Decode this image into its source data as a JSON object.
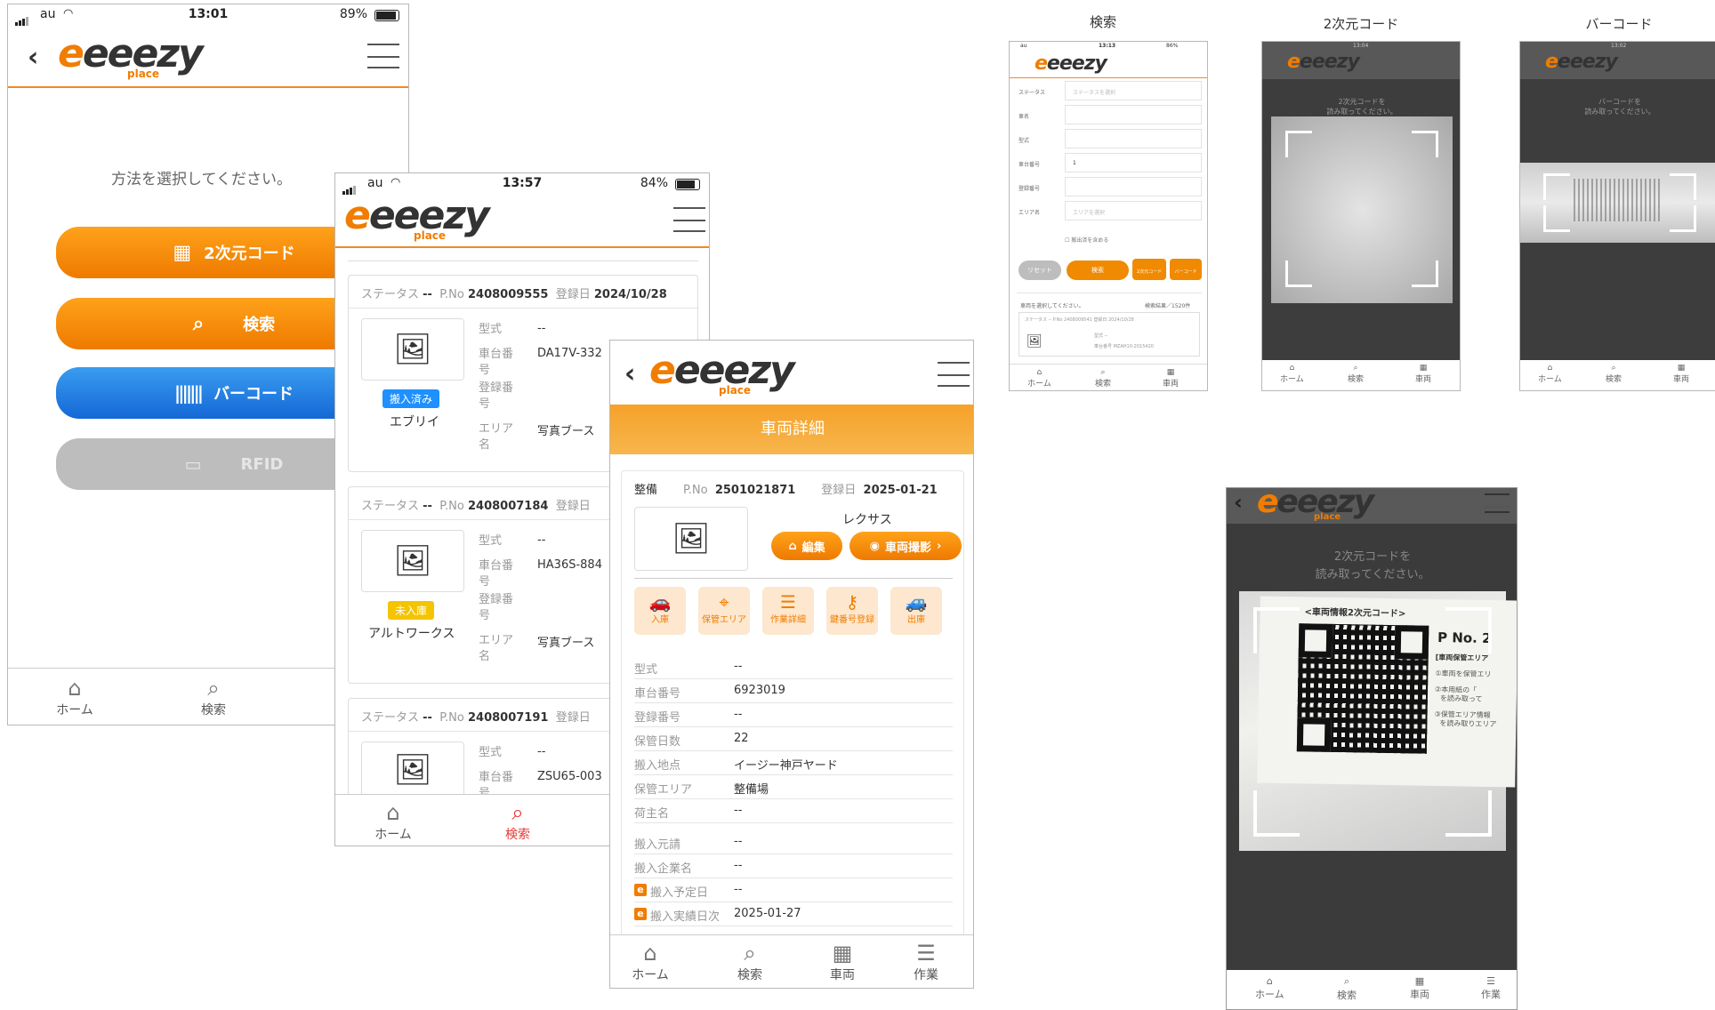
{
  "status": {
    "carrier": "au",
    "p1_time": "13:01",
    "p1_battery": "89%",
    "p2_time": "13:57",
    "p2_battery": "84%",
    "s1_time": "13:13",
    "s1_battery": "86%",
    "s2_time": "13:04",
    "s2_battery": "88%",
    "s3_time": "13:02",
    "s3_battery": "89%"
  },
  "logo": {
    "text_e": "e",
    "text_rest": "eeezy",
    "sub": "place"
  },
  "home": {
    "prompt": "方法を選択してください。",
    "buttons": [
      {
        "label": "2次元コード",
        "icon": "qr-code-icon"
      },
      {
        "label": "検索",
        "icon": "search-icon"
      },
      {
        "label": "バーコード",
        "icon": "barcode-icon"
      },
      {
        "label": "RFID",
        "icon": "rfid-icon"
      }
    ]
  },
  "tabs": {
    "home": "ホーム",
    "search": "検索",
    "vehicle": "車両",
    "work": "作業"
  },
  "list": {
    "cards": [
      {
        "status_label": "ステータス",
        "status": "--",
        "pno_label": "P.No",
        "pno": "2408009555",
        "date_label": "登録日",
        "date": "2024/10/28",
        "badge": "搬入済み",
        "badge_color": "#1e90ff",
        "name": "エブリイ",
        "model_label": "型式",
        "model": "--",
        "chassis_label": "車台番号",
        "chassis": "DA17V-332",
        "reg_label": "登録番号",
        "area_label": "エリア名",
        "area": "写真ブース"
      },
      {
        "status_label": "ステータス",
        "status": "--",
        "pno_label": "P.No",
        "pno": "2408007184",
        "date_label": "登録日",
        "badge": "未入庫",
        "badge_color": "#f5c400",
        "name": "アルトワークス",
        "model_label": "型式",
        "model": "--",
        "chassis_label": "車台番号",
        "chassis": "HA36S-884",
        "reg_label": "登録番号",
        "area_label": "エリア名",
        "area": "写真ブース"
      },
      {
        "status_label": "ステータス",
        "status": "--",
        "pno_label": "P.No",
        "pno": "2408007191",
        "date_label": "登録日",
        "model_label": "型式",
        "model": "--",
        "chassis_label": "車台番号",
        "chassis": "ZSU65-003"
      }
    ]
  },
  "detail": {
    "title": "車両詳細",
    "status": "整備",
    "pno_label": "P.No",
    "pno": "2501021871",
    "date_label": "登録日",
    "date": "2025-01-21",
    "maker": "レクサス",
    "edit": "編集",
    "photo": "車両撮影",
    "actions": [
      "入庫",
      "保管エリア",
      "作業詳細",
      "鍵番号登録",
      "出庫"
    ],
    "rows": [
      {
        "label": "型式",
        "value": "--"
      },
      {
        "label": "車台番号",
        "value": "6923019"
      },
      {
        "label": "登録番号",
        "value": "--"
      },
      {
        "label": "保管日数",
        "value": "22"
      },
      {
        "label": "搬入地点",
        "value": "イージー神戸ヤード"
      },
      {
        "label": "保管エリア",
        "value": "整備場"
      },
      {
        "label": "荷主名",
        "value": "--"
      },
      {
        "label": "搬入元請",
        "value": "--"
      },
      {
        "label": "搬入企業名",
        "value": "--"
      },
      {
        "label": "搬入予定日",
        "value": "--"
      },
      {
        "label": "搬入実績日次",
        "value": "2025-01-27"
      }
    ]
  },
  "shots": {
    "search_title": "検索",
    "qr_title": "2次元コード",
    "barcode_title": "バーコード",
    "search_form": {
      "fields": [
        {
          "label": "ステータス",
          "value": "ステータスを選択"
        },
        {
          "label": "車名",
          "value": ""
        },
        {
          "label": "型式",
          "value": ""
        },
        {
          "label": "車台番号",
          "value": "1"
        },
        {
          "label": "登録番号",
          "value": ""
        },
        {
          "label": "エリア名",
          "value": "エリアを選択"
        }
      ],
      "checkbox": "搬出済を含める",
      "reset": "リセット",
      "search": "検索",
      "qr": "2次元コード",
      "barcode": "バーコード",
      "hint": "車両を選択してください。",
      "result": "検索結果／1520件",
      "card_line": "ステータス -- P.No 2408009541 登録日 2024/10/28",
      "card_model": "型式 --",
      "card_chassis": "車台番号 MZAH10-2015420"
    },
    "qr_prompt": "2次元コードを\n読み取ってください。",
    "barcode_prompt": "バーコードを\n読み取ってください。",
    "big_qr_prompt_1": "2次元コードを",
    "big_qr_prompt_2": "読み取ってください。",
    "doc_heading": "<車両情報2次元コード>",
    "doc_pno": "P No. 2",
    "doc_side_1": "[車両保管エリア",
    "doc_side_2": "①車両を保管エリ",
    "doc_side_3": "②本用紙の「",
    "doc_side_4": "を読み取って",
    "doc_side_5": "③保管エリア情報",
    "doc_side_6": "を読み取りエリア"
  }
}
